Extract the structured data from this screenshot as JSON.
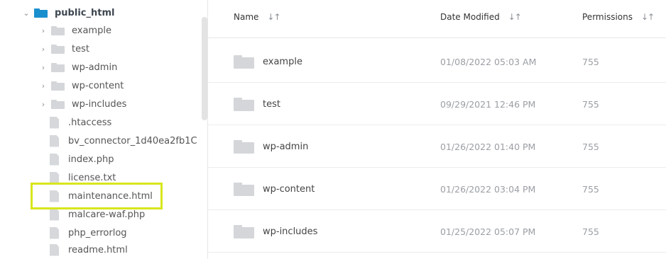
{
  "tree": {
    "root": {
      "label": "public_html",
      "expanded": true,
      "icon": "folder-icon",
      "color": "#1a8fce"
    },
    "folders": [
      {
        "label": "example"
      },
      {
        "label": "test"
      },
      {
        "label": "wp-admin"
      },
      {
        "label": "wp-content"
      },
      {
        "label": "wp-includes"
      }
    ],
    "files": [
      {
        "label": ".htaccess"
      },
      {
        "label": "bv_connector_1d40ea2fb1C"
      },
      {
        "label": "index.php"
      },
      {
        "label": "license.txt"
      },
      {
        "label": "maintenance.html",
        "highlighted": true
      },
      {
        "label": "malcare-waf.php"
      },
      {
        "label": "php_errorlog"
      },
      {
        "label": "readme.html"
      }
    ],
    "highlight_color": "#d8e61c"
  },
  "table": {
    "columns": [
      {
        "label": "Name",
        "sort_icon": "sort-arrows-icon"
      },
      {
        "label": "Date Modified",
        "sort_icon": "sort-arrows-icon"
      },
      {
        "label": "Permissions",
        "sort_icon": "sort-arrows-icon"
      }
    ],
    "rows": [
      {
        "name": "example",
        "date": "01/08/2022 05:03 AM",
        "perm": "755"
      },
      {
        "name": "test",
        "date": "09/29/2021 12:46 PM",
        "perm": "755"
      },
      {
        "name": "wp-admin",
        "date": "01/26/2022 01:40 PM",
        "perm": "755"
      },
      {
        "name": "wp-content",
        "date": "01/26/2022 03:04 PM",
        "perm": "755"
      },
      {
        "name": "wp-includes",
        "date": "01/25/2022 05:07 PM",
        "perm": "755"
      }
    ]
  }
}
